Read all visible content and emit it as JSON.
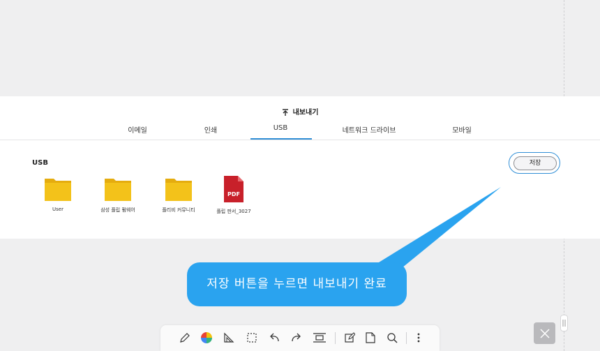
{
  "header": {
    "title": "내보내기",
    "icon": "export-icon"
  },
  "tabs": [
    {
      "label": "이메일"
    },
    {
      "label": "인쇄"
    },
    {
      "label": "USB",
      "selected": true
    },
    {
      "label": "네트워크 드라이브"
    },
    {
      "label": "모바일"
    }
  ],
  "section": {
    "label": "USB"
  },
  "save_button": {
    "label": "저장"
  },
  "files": [
    {
      "name": "User",
      "type": "folder"
    },
    {
      "name": "삼성 플립 펌웨어",
      "type": "folder"
    },
    {
      "name": "플리비 커뮤니티",
      "type": "folder"
    },
    {
      "name": "플립 판서_3027",
      "type": "pdf",
      "badge": "PDF"
    }
  ],
  "callout": {
    "text": "저장 버튼을 누르면 내보내기 완료"
  },
  "toolbar": {
    "tools": [
      "pen-icon",
      "color-wheel-icon",
      "ruler-icon",
      "select-icon",
      "undo-icon",
      "redo-icon",
      "layout-icon",
      "edit-page-icon",
      "page-icon",
      "search-icon",
      "more-icon"
    ]
  },
  "colors": {
    "accent": "#2f8ed6",
    "callout": "#2aa3ef",
    "folder": "#f3c21a",
    "pdf": "#c8202a"
  }
}
